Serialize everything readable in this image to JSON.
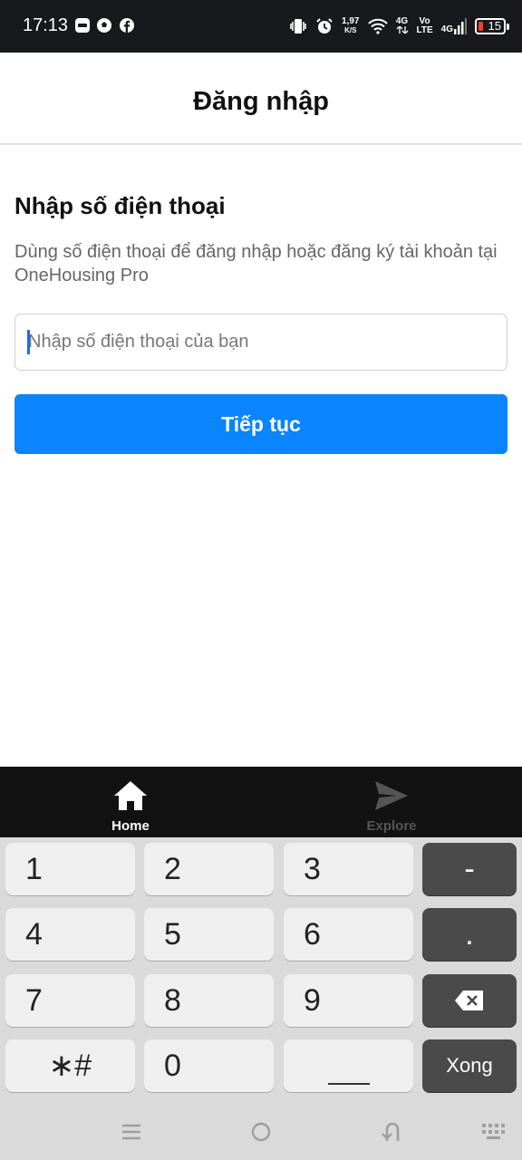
{
  "status_bar": {
    "time": "17:13",
    "net_speed_value": "1,97",
    "net_speed_unit": "K/S",
    "network_1": "4G",
    "volte_top": "Vo",
    "volte_bottom": "LTE",
    "network_2": "4G",
    "battery": "15"
  },
  "header": {
    "title": "Đăng nhập"
  },
  "main": {
    "heading": "Nhập số điện thoại",
    "subtitle": "Dùng số điện thoại để đăng nhập hoặc đăng ký tài khoản tại OneHousing Pro",
    "phone_input": {
      "value": "",
      "placeholder": "Nhập số điện thoại của bạn"
    },
    "continue_label": "Tiếp tục"
  },
  "tabbar": {
    "home": {
      "label": "Home",
      "icon": "home-icon"
    },
    "explore": {
      "label": "Explore",
      "icon": "send-icon"
    }
  },
  "keyboard": {
    "k1": "1",
    "k2": "2",
    "k3": "3",
    "minus": "-",
    "k4": "4",
    "k5": "5",
    "k6": "6",
    "dot": ".",
    "k7": "7",
    "k8": "8",
    "k9": "9",
    "symbols": "∗#",
    "k0": "0",
    "done": "Xong"
  },
  "colors": {
    "accent": "#0a84ff",
    "battery_low": "#ff3b30"
  }
}
